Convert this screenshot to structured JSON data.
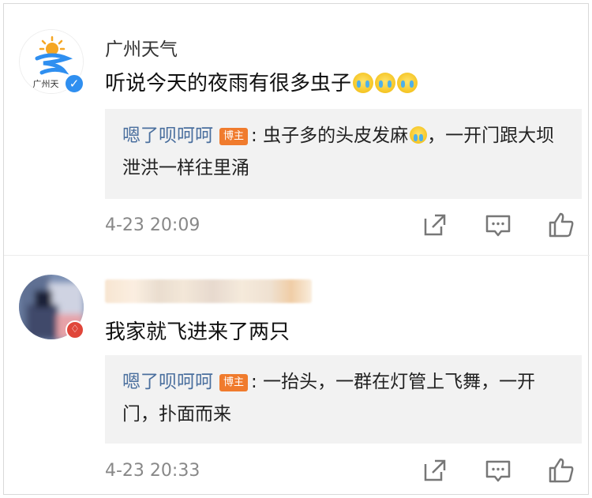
{
  "comments": [
    {
      "username": "广州天气",
      "avatar_label": "广州天",
      "verified_mark": "✓",
      "content": "听说今天的夜雨有很多虫子",
      "reply": {
        "user": "嗯了呗呵呵",
        "badge": "博主",
        "text": "虫子多的头皮发麻",
        "text_tail": "，一开门跟大坝泄洪一样往里涌"
      },
      "time": "4-23 20:09"
    },
    {
      "username": "",
      "vip_mark": "♢",
      "content": "我家就飞进来了两只",
      "reply": {
        "user": "嗯了呗呵呵",
        "badge": "博主",
        "text": "一抬头，一群在灯管上飞舞，一开门，扑面而来"
      },
      "time": "4-23 20:33"
    }
  ],
  "icons": [
    "share-icon",
    "comment-icon",
    "like-icon"
  ],
  "colors": {
    "reply_user": "#4a6f9e",
    "badge": "#f07b2d",
    "verified": "#2f8ff0",
    "reply_bg": "#f2f2f2"
  }
}
